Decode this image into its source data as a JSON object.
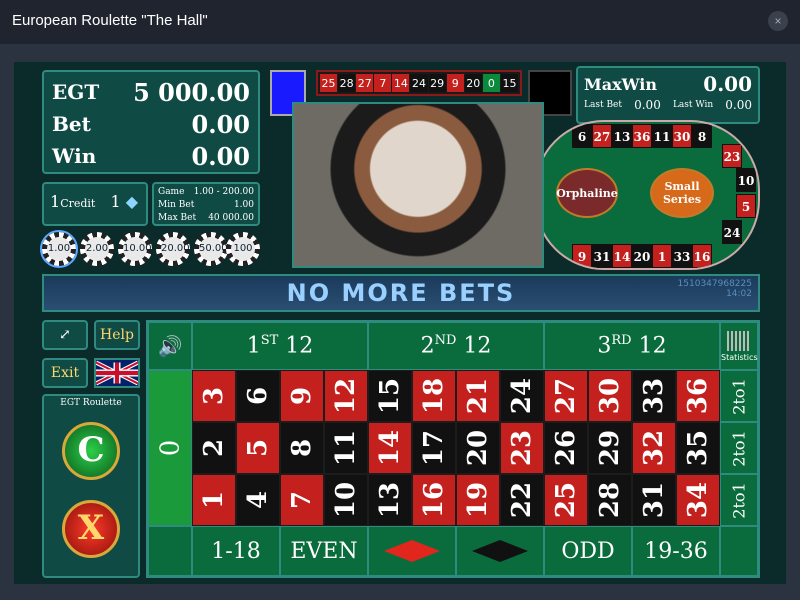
{
  "window": {
    "title": "European Roulette \"The Hall\"",
    "close_symbol": "×"
  },
  "balance": {
    "player_label": "EGT",
    "player_value": "5 000.00",
    "bet_label": "Bet",
    "bet_value": "0.00",
    "win_label": "Win",
    "win_value": "0.00"
  },
  "credit": {
    "label": "Credit",
    "prefix": "1",
    "value": "1"
  },
  "limits": {
    "game_label": "Game",
    "game_value": "1.00 - 200.00",
    "min_label": "Min Bet",
    "min_value": "1.00",
    "max_label": "Max Bet",
    "max_value": "40 000.00"
  },
  "chips": [
    "1.00",
    "2.00",
    "10.00",
    "20.00",
    "50.00",
    "100"
  ],
  "history": [
    "25",
    "28",
    "27",
    "7",
    "14",
    "24",
    "29",
    "9",
    "20",
    "0",
    "15"
  ],
  "maxwin": {
    "label": "MaxWin",
    "value": "0.00",
    "last_bet_label": "Last Bet",
    "last_bet_value": "0.00",
    "last_win_label": "Last Win",
    "last_win_value": "0.00"
  },
  "racetrack": {
    "top": [
      "6",
      "27",
      "13",
      "36",
      "11",
      "30",
      "8"
    ],
    "right": [
      "23",
      "10",
      "5",
      "24"
    ],
    "bottom": [
      "9",
      "31",
      "14",
      "20",
      "1",
      "33",
      "16"
    ],
    "orphaline": "Orphaline",
    "small_series": "Small Series"
  },
  "status": {
    "message": "NO MORE BETS",
    "id_line": "1510347968225",
    "time": "14:02"
  },
  "controls": {
    "fullscreen": "⤢",
    "help": "Help",
    "exit": "Exit",
    "language": "UK",
    "panel_title": "EGT Roulette",
    "clear": "C",
    "cancel": "X"
  },
  "board": {
    "sound": "🔊",
    "zero": "0",
    "dozens": [
      {
        "main": "1",
        "sup": "ST",
        "rest": " 12"
      },
      {
        "main": "2",
        "sup": "ND",
        "rest": " 12"
      },
      {
        "main": "3",
        "sup": "RD",
        "rest": " 12"
      }
    ],
    "statistics": "Statistics",
    "numbers_top": [
      "3",
      "6",
      "9",
      "12",
      "15",
      "18",
      "21",
      "24",
      "27",
      "30",
      "33",
      "36"
    ],
    "numbers_mid": [
      "2",
      "5",
      "8",
      "11",
      "14",
      "17",
      "20",
      "23",
      "26",
      "29",
      "32",
      "35"
    ],
    "numbers_bot": [
      "1",
      "4",
      "7",
      "10",
      "13",
      "16",
      "19",
      "22",
      "25",
      "28",
      "31",
      "34"
    ],
    "columns": [
      "2to1",
      "2to1",
      "2to1"
    ],
    "outside": [
      "1-18",
      "EVEN",
      "",
      "",
      "ODD",
      "19-36"
    ]
  }
}
